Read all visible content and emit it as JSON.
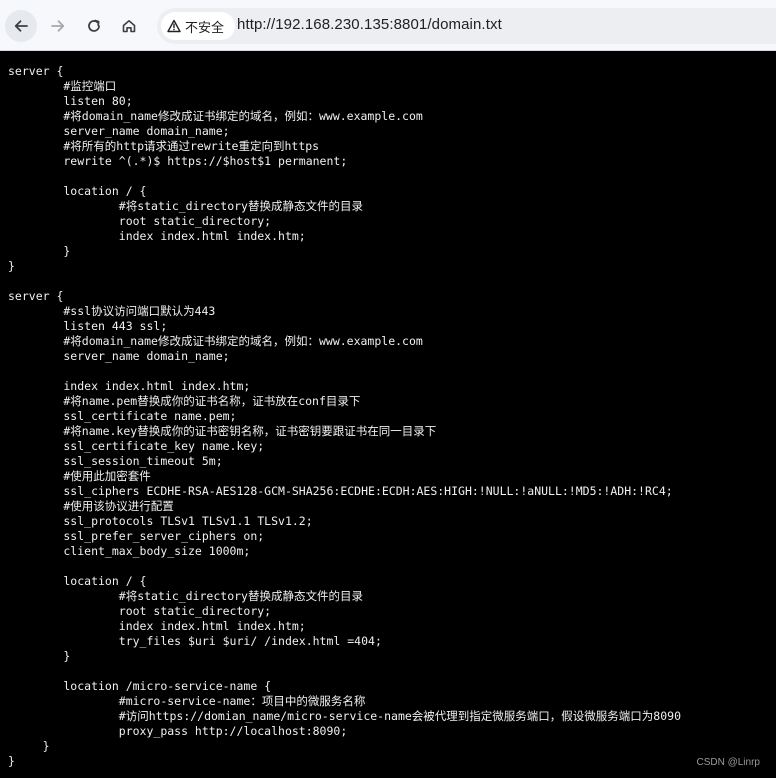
{
  "browser": {
    "security_label": "不安全",
    "url": "http://192.168.230.135:8801/domain.txt",
    "icons": {
      "back": "arrow-left-icon",
      "forward": "arrow-right-icon",
      "reload": "reload-icon",
      "home": "home-icon",
      "security": "warning-triangle-icon"
    }
  },
  "file": {
    "lines": [
      "server {",
      "        #监控端口",
      "        listen 80;",
      "        #将domain_name修改成证书绑定的域名，例如：www.example.com",
      "        server_name domain_name;",
      "        #将所有的http请求通过rewrite重定向到https",
      "        rewrite ^(.*)$ https://$host$1 permanent;",
      "",
      "        location / {",
      "                #将static_directory替换成静态文件的目录",
      "                root static_directory;",
      "                index index.html index.htm;",
      "        }",
      "}",
      "",
      "server {",
      "        #ssl协议访问端口默认为443",
      "        listen 443 ssl;",
      "        #将domain_name修改成证书绑定的域名，例如：www.example.com",
      "        server_name domain_name;",
      "",
      "        index index.html index.htm;",
      "        #将name.pem替换成你的证书名称，证书放在conf目录下",
      "        ssl_certificate name.pem;",
      "        #将name.key替换成你的证书密钥名称，证书密钥要跟证书在同一目录下",
      "        ssl_certificate_key name.key;",
      "        ssl_session_timeout 5m;",
      "        #使用此加密套件",
      "        ssl_ciphers ECDHE-RSA-AES128-GCM-SHA256:ECDHE:ECDH:AES:HIGH:!NULL:!aNULL:!MD5:!ADH:!RC4;",
      "        #使用该协议进行配置",
      "        ssl_protocols TLSv1 TLSv1.1 TLSv1.2;",
      "        ssl_prefer_server_ciphers on;",
      "        client_max_body_size 1000m;",
      "",
      "        location / {",
      "                #将static_directory替换成静态文件的目录",
      "                root static_directory;",
      "                index index.html index.htm;",
      "                try_files $uri $uri/ /index.html =404;",
      "        }",
      "",
      "        location /micro-service-name {",
      "                #micro-service-name：项目中的微服务名称",
      "                #访问https://domian_name/micro-service-name会被代理到指定微服务端口，假设微服务端口为8090",
      "                proxy_pass http://localhost:8090;",
      "     }",
      "}"
    ]
  },
  "watermark": "CSDN @Linrp"
}
